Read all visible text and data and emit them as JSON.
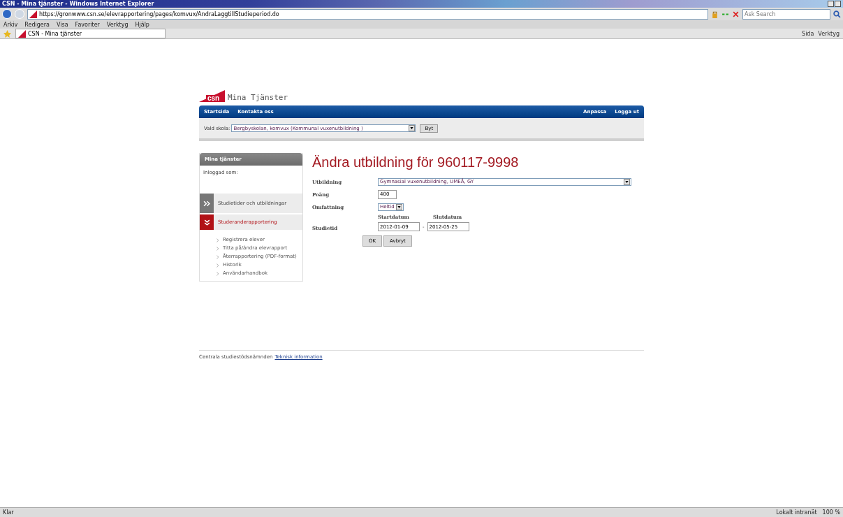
{
  "browser": {
    "title": "CSN - Mina tjänster - Windows Internet Explorer",
    "address": "https://gronwww.csn.se/elevrapportering/pages/komvux/AndraLaggtillStudieperiod.do",
    "search_placeholder": "Ask Search",
    "menu": [
      "Arkiv",
      "Redigera",
      "Visa",
      "Favoriter",
      "Verktyg",
      "Hjälp"
    ],
    "tab_title": "CSN - Mina tjänster",
    "tools": [
      "Sida",
      "Verktyg"
    ],
    "status": "Klar",
    "zone": "Lokalt intranät",
    "zoom": "100 %"
  },
  "logo": {
    "mark": "csn",
    "text": "Mina Tjänster"
  },
  "nav": {
    "left": [
      "Startsida",
      "Kontakta oss"
    ],
    "right": [
      "Anpassa",
      "Logga ut"
    ]
  },
  "school": {
    "label": "Vald skola:",
    "value": "Bergbyskolan, komvux (Kommunal vuxenutbildning )",
    "button": "Byt"
  },
  "sidebar": {
    "header": "Mina tjänster",
    "logged_in": "Inloggad som:",
    "sections": [
      {
        "label": "Studietider och utbildningar",
        "expanded": false
      },
      {
        "label": "Studeranderapportering",
        "expanded": true,
        "children": [
          {
            "label": "Registrera elever"
          },
          {
            "label": "Titta på/ändra elevrapport"
          },
          {
            "label": "Återrapportering (PDF-format)"
          },
          {
            "label": "Historik"
          },
          {
            "label": "Användarhandbok"
          }
        ]
      }
    ]
  },
  "form": {
    "heading": "Ändra utbildning för 960117-9998",
    "fields": [
      {
        "kind": "select",
        "label": "Utbildning",
        "value": "Gymnasial vuxenutbildning, UMEÅ, GY"
      },
      {
        "kind": "text",
        "label": "Poäng",
        "value": "400"
      },
      {
        "kind": "select",
        "label": "Omfattning",
        "value": "Heltid"
      },
      {
        "kind": "daterange",
        "label": "Studietid",
        "start_label": "Startdatum",
        "end_label": "Slutdatum",
        "start": "2012-01-09",
        "separator": "-",
        "end": "2012-05-25"
      }
    ],
    "buttons": [
      "OK",
      "Avbryt"
    ]
  },
  "footer": {
    "text": "Centrala studiestödsnämnden",
    "link": "Teknisk information"
  }
}
